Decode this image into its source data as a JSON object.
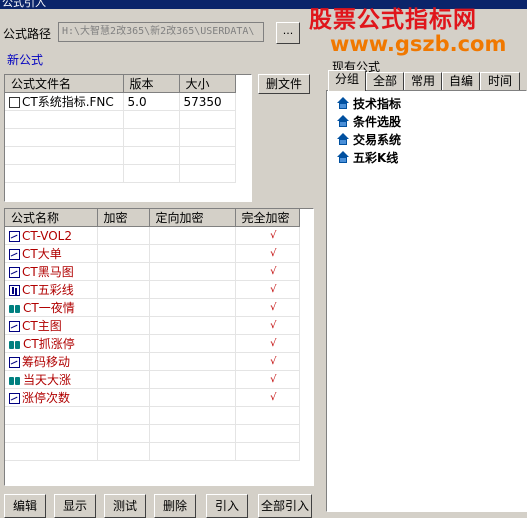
{
  "window": {
    "title": "公式引入"
  },
  "path_row": {
    "label": "公式路径",
    "value": "H:\\大智慧2改365\\新2改365\\USERDATA\\",
    "browse_label": "..."
  },
  "new_formula_group": {
    "title": "新公式"
  },
  "file_list": {
    "columns": [
      "公式文件名",
      "版本",
      "大小"
    ],
    "rows": [
      {
        "name": "CT系统指标.FNC",
        "version": "5.0",
        "size": "57350"
      }
    ],
    "delete_button": "删文件"
  },
  "formula_list": {
    "columns": [
      "公式名称",
      "加密",
      "定向加密",
      "完全加密"
    ],
    "rows": [
      {
        "name": "CT-VOL2",
        "icon": "chart-icon",
        "check": "√"
      },
      {
        "name": "CT大单",
        "icon": "chart-icon",
        "check": "√"
      },
      {
        "name": "CT黑马图",
        "icon": "chart-icon",
        "check": "√"
      },
      {
        "name": "CT五彩线",
        "icon": "candle-icon",
        "check": "√"
      },
      {
        "name": "CT一夜情",
        "icon": "binoculars-icon",
        "check": "√"
      },
      {
        "name": "CT主图",
        "icon": "chart-icon",
        "check": "√"
      },
      {
        "name": "CT抓涨停",
        "icon": "binoculars-icon",
        "check": "√"
      },
      {
        "name": "筹码移动",
        "icon": "chart-icon",
        "check": "√"
      },
      {
        "name": "当天大涨",
        "icon": "binoculars-icon",
        "check": "√"
      },
      {
        "name": "涨停次数",
        "icon": "chart-icon",
        "check": "√"
      }
    ]
  },
  "bottom_buttons": [
    "编辑",
    "显示",
    "测试",
    "删除",
    "引入",
    "全部引入"
  ],
  "right_panel": {
    "group_title": "现有公式",
    "tabs": [
      "分组",
      "全部",
      "常用",
      "自编",
      "时间"
    ],
    "active_tab": "分组",
    "tree_items": [
      "技术指标",
      "条件选股",
      "交易系统",
      "五彩K线"
    ]
  },
  "watermark": {
    "line1": "股票公式指标网",
    "line2": "www.gszb.com"
  },
  "colors": {
    "title_bar": "#0a246a",
    "accent_text": "#0000c0",
    "check": "#c00000",
    "watermark_red": "#e0151b",
    "watermark_orange": "#f07800"
  }
}
